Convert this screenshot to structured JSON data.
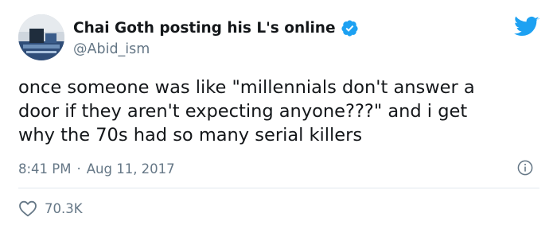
{
  "tweet": {
    "author": {
      "display_name": "Chai Goth posting his L's online",
      "handle": "@Abid_ism",
      "verified": true
    },
    "text": "once someone was like \"millennials don't answer a\ndoor if they aren't expecting anyone???\" and i get\nwhy the 70s had so many serial killers",
    "timestamp": {
      "time": "8:41 PM",
      "separator": "·",
      "date": "Aug 11, 2017"
    },
    "likes": "70.3K"
  },
  "colors": {
    "brand_blue": "#1da1f2",
    "text_primary": "#14171a",
    "text_secondary": "#657786",
    "divider": "#e1e8ed"
  },
  "icons": {
    "logo": "twitter-bird-icon",
    "verified": "verified-badge-icon",
    "info": "info-icon",
    "like": "heart-icon"
  }
}
